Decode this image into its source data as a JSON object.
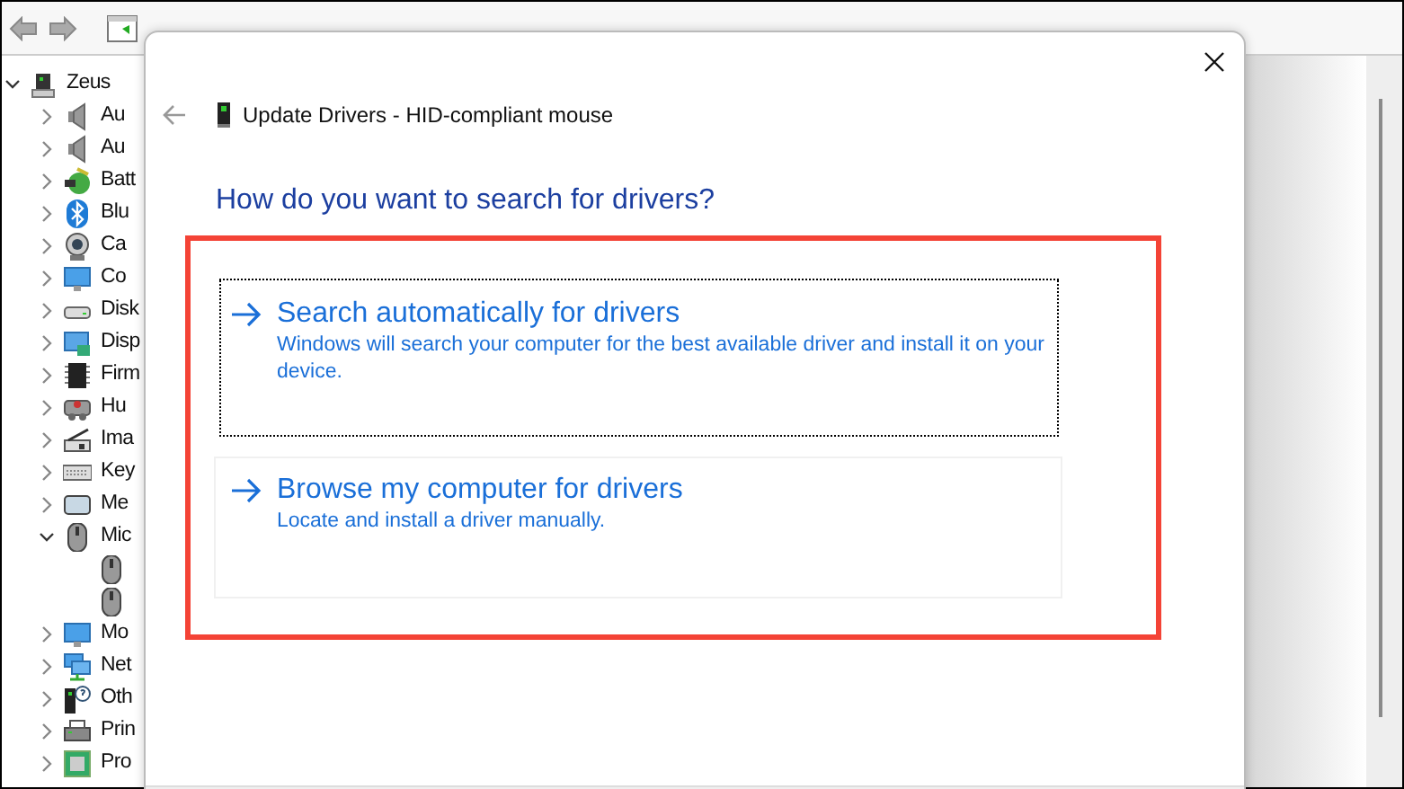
{
  "device_tree": {
    "label": "Zeus",
    "kind": "computer",
    "expanded": true,
    "children": [
      {
        "label": "Au",
        "kind": "audio",
        "expanded": false
      },
      {
        "label": "Au",
        "kind": "audio",
        "expanded": false
      },
      {
        "label": "Batt",
        "kind": "battery",
        "expanded": false
      },
      {
        "label": "Blu",
        "kind": "bluetooth",
        "expanded": false
      },
      {
        "label": "Ca",
        "kind": "camera",
        "expanded": false
      },
      {
        "label": "Co",
        "kind": "monitor",
        "expanded": false
      },
      {
        "label": "Disk",
        "kind": "disk",
        "expanded": false
      },
      {
        "label": "Disp",
        "kind": "display",
        "expanded": false
      },
      {
        "label": "Firm",
        "kind": "chip",
        "expanded": false
      },
      {
        "label": "Hu",
        "kind": "hid",
        "expanded": false
      },
      {
        "label": "Ima",
        "kind": "scanner",
        "expanded": false
      },
      {
        "label": "Key",
        "kind": "keyboard",
        "expanded": false
      },
      {
        "label": "Me",
        "kind": "memory",
        "expanded": false
      },
      {
        "label": "Mic",
        "kind": "mouse",
        "expanded": true,
        "children": [
          {
            "kind": "mouse"
          },
          {
            "kind": "mouse"
          }
        ]
      },
      {
        "label": "Mo",
        "kind": "monitor",
        "expanded": false
      },
      {
        "label": "Net",
        "kind": "network",
        "expanded": false
      },
      {
        "label": "Oth",
        "kind": "unknown",
        "expanded": false
      },
      {
        "label": "Prin",
        "kind": "printer",
        "expanded": false
      },
      {
        "label": "Pro",
        "kind": "processor",
        "expanded": false
      }
    ]
  },
  "dialog": {
    "title": "Update Drivers - HID-compliant mouse",
    "heading": "How do you want to search for drivers?",
    "options": [
      {
        "title": "Search automatically for drivers",
        "description": "Windows will search your computer for the best available driver and install it on your device.",
        "focused": true
      },
      {
        "title": "Browse my computer for drivers",
        "description": "Locate and install a driver manually.",
        "focused": false
      }
    ]
  }
}
